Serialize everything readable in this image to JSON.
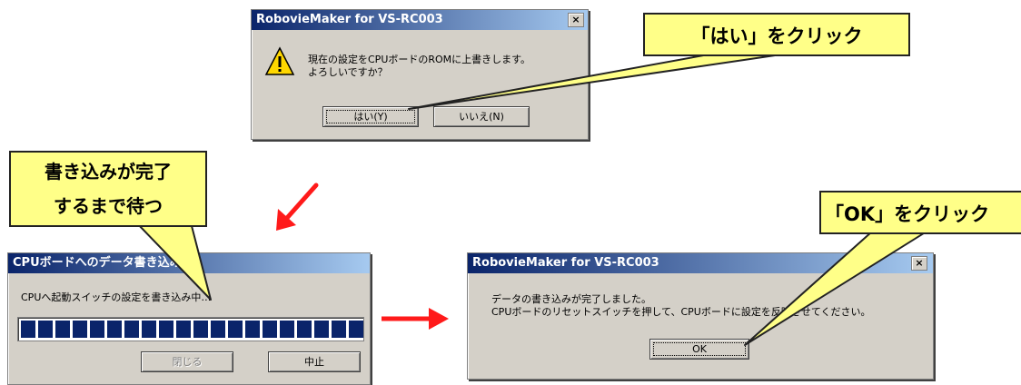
{
  "dialog_top": {
    "title": "RobovieMaker for VS-RC003",
    "close_label": "×",
    "message_line1": "現在の設定をCPUボードのROMに上書きします。",
    "message_line2": "よろしいですか？",
    "yes_button": "はい(Y)",
    "no_button": "いいえ(N)"
  },
  "dialog_progress": {
    "title": "CPUボードへのデータ書き込み",
    "message": "CPUへ起動スイッチの設定を書き込み中…",
    "progress_percent": 100,
    "close_button": "閉じる",
    "cancel_button": "中止"
  },
  "dialog_done": {
    "title": "RobovieMaker for VS-RC003",
    "close_label": "×",
    "message_line1": "データの書き込みが完了しました。",
    "message_line2": "CPUボードのリセットスイッチを押して、CPUボードに設定を反映させてください。",
    "ok_button": "OK"
  },
  "callouts": {
    "yes_instruction": "「はい」をクリック",
    "wait_line1": "書き込みが完了",
    "wait_line2": "するまで待つ",
    "ok_instruction": "「OK」をクリック"
  },
  "colors": {
    "callout_fill": "#ffff88",
    "arrow": "#ff1a1a",
    "titlebar_start": "#0a246a",
    "titlebar_end": "#a6caf0",
    "dialog_face": "#d4d0c8"
  }
}
